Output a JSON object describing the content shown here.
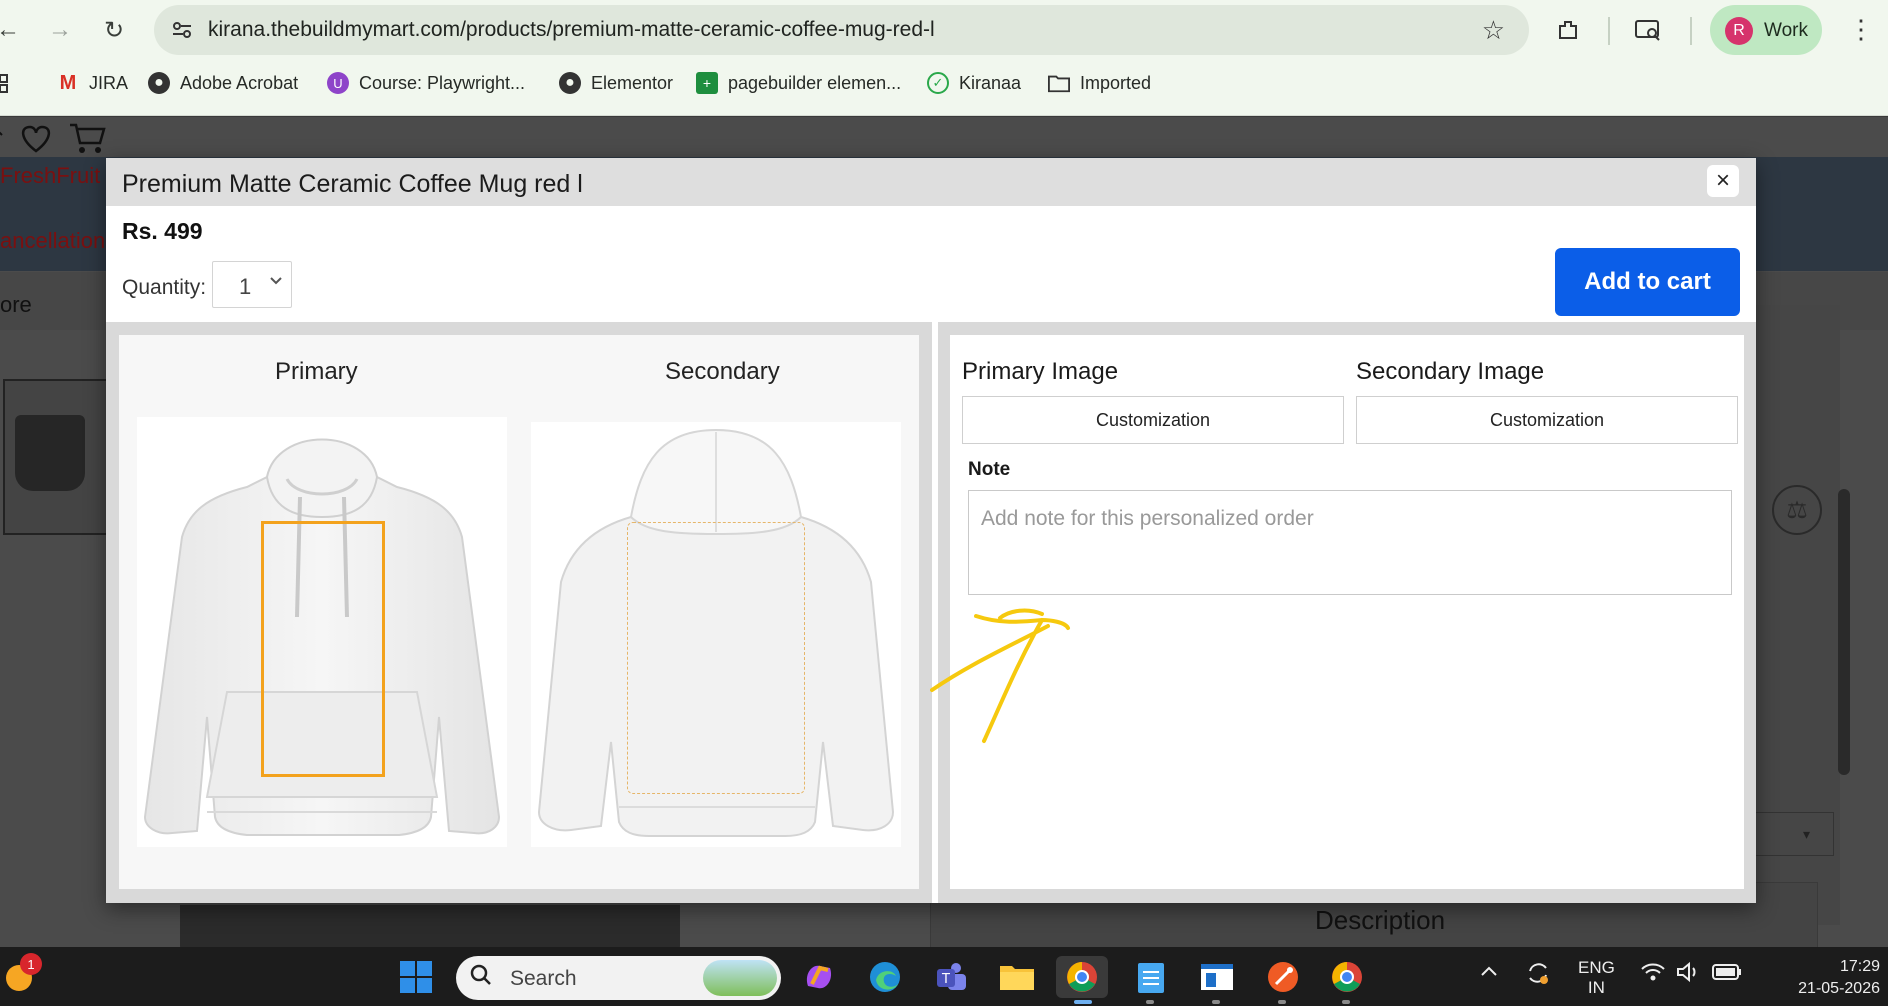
{
  "browser": {
    "url": "kirana.thebuildmymart.com/products/premium-matte-ceramic-coffee-mug-red-l",
    "profile_initial": "R",
    "profile_label": "Work",
    "bookmarks": [
      "JIRA",
      "Adobe Acrobat",
      "Course: Playwright...",
      "Elementor",
      "pagebuilder elemen...",
      "Kiranaa",
      "Imported"
    ]
  },
  "background_page": {
    "header_text_1": "FreshFruit",
    "header_text_2": "ancellation",
    "more_text": "ore",
    "description_heading": "Description"
  },
  "modal": {
    "title": "Premium Matte Ceramic Coffee Mug red l",
    "price": "Rs. 499",
    "quantity_label": "Quantity:",
    "quantity_value": "1",
    "add_to_cart_label": "Add to cart",
    "close_symbol": "×",
    "preview": {
      "primary_label": "Primary",
      "secondary_label": "Secondary"
    },
    "customization": {
      "primary_image_title": "Primary Image",
      "secondary_image_title": "Secondary Image",
      "primary_button_label": "Customization",
      "secondary_button_label": "Customization",
      "note_label": "Note",
      "note_placeholder": "Add note for this personalized order",
      "note_value": ""
    }
  },
  "taskbar": {
    "weather_badge": "1",
    "search_placeholder": "Search",
    "language_line1": "ENG",
    "language_line2": "IN",
    "time": "17:29",
    "date": "21-05-2026"
  },
  "colors": {
    "accent_button": "#0b5ee8",
    "print_area_outline": "#f3a21d",
    "annotation_arrow": "#f6c90e",
    "modal_header": "#dedede"
  }
}
